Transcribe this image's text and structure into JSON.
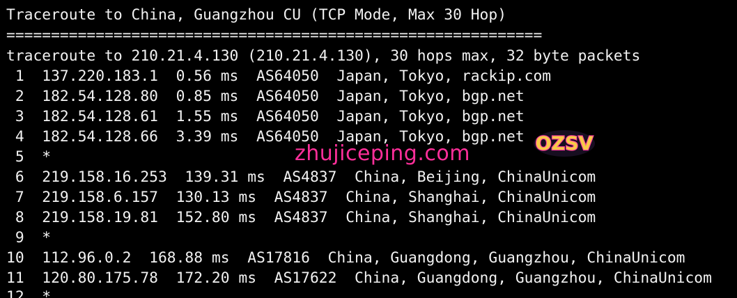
{
  "terminal": {
    "background": "#000000",
    "foreground": "#f2f2f2",
    "lines": [
      "Traceroute to China, Guangzhou CU (TCP Mode, Max 30 Hop)",
      "============================================================",
      "traceroute to 210.21.4.130 (210.21.4.130), 30 hops max, 32 byte packets",
      " 1  137.220.183.1  0.56 ms  AS64050  Japan, Tokyo, rackip.com",
      " 2  182.54.128.80  0.85 ms  AS64050  Japan, Tokyo, bgp.net",
      " 3  182.54.128.61  1.55 ms  AS64050  Japan, Tokyo, bgp.net",
      " 4  182.54.128.66  3.39 ms  AS64050  Japan, Tokyo, bgp.net",
      " 5  *",
      " 6  219.158.16.253  139.31 ms  AS4837  China, Beijing, ChinaUnicom",
      " 7  219.158.6.157  130.13 ms  AS4837  China, Shanghai, ChinaUnicom",
      " 8  219.158.19.81  152.80 ms  AS4837  China, Shanghai, ChinaUnicom",
      " 9  *",
      "10  112.96.0.2  168.88 ms  AS17816  China, Guangdong, Guangzhou, ChinaUnicom",
      "11  120.80.175.78  172.20 ms  AS17622  China, Guangdong, Guangzhou, ChinaUnicom",
      "12  *"
    ]
  },
  "watermark": {
    "logo_text": "OZSV",
    "site_text": "zhujiceping.com",
    "color": "#ff2f9a"
  }
}
